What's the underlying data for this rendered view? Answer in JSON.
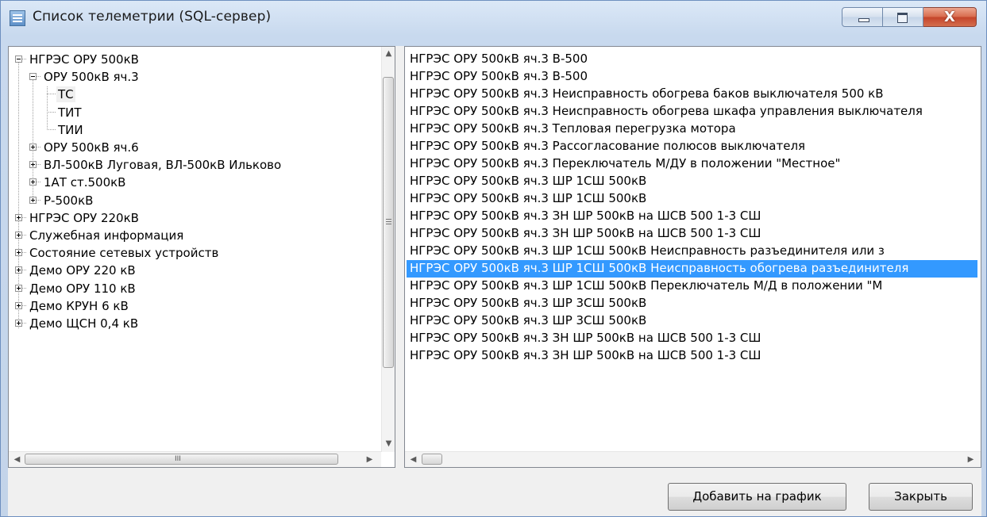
{
  "window": {
    "title": "Список телеметрии (SQL-сервер)",
    "close_glyph": "X"
  },
  "tree": {
    "nodes": [
      {
        "label": "НГРЭС ОРУ 500кВ",
        "level": 0,
        "state": "expanded"
      },
      {
        "label": "ОРУ 500кВ яч.3",
        "level": 1,
        "state": "expanded"
      },
      {
        "label": "ТС",
        "level": 2,
        "state": "leaf",
        "selected": true
      },
      {
        "label": "ТИТ",
        "level": 2,
        "state": "leaf"
      },
      {
        "label": "ТИИ",
        "level": 2,
        "state": "leaf"
      },
      {
        "label": "ОРУ 500кВ яч.6",
        "level": 1,
        "state": "collapsed"
      },
      {
        "label": "ВЛ-500кВ Луговая, ВЛ-500кВ Ильково",
        "level": 1,
        "state": "collapsed"
      },
      {
        "label": "1АТ ст.500кВ",
        "level": 1,
        "state": "collapsed"
      },
      {
        "label": "Р-500кВ",
        "level": 1,
        "state": "collapsed"
      },
      {
        "label": "НГРЭС ОРУ 220кВ",
        "level": 0,
        "state": "collapsed"
      },
      {
        "label": "Служебная информация",
        "level": 0,
        "state": "collapsed"
      },
      {
        "label": "Состояние сетевых устройств",
        "level": 0,
        "state": "collapsed"
      },
      {
        "label": "Демо ОРУ 220 кВ",
        "level": 0,
        "state": "collapsed"
      },
      {
        "label": "Демо ОРУ 110 кВ",
        "level": 0,
        "state": "collapsed"
      },
      {
        "label": "Демо КРУН 6 кВ",
        "level": 0,
        "state": "collapsed"
      },
      {
        "label": "Демо ЩСН 0,4 кВ",
        "level": 0,
        "state": "collapsed"
      }
    ],
    "vscroll_up": "▲",
    "vscroll_down": "▼",
    "hscroll_left": "◀",
    "hscroll_right": "▶",
    "hgrip": "III"
  },
  "list": {
    "items": [
      "НГРЭС ОРУ 500кВ яч.3 В-500",
      "НГРЭС ОРУ 500кВ яч.3 В-500",
      "НГРЭС ОРУ 500кВ яч.3 Неисправность обогрева баков выключателя 500 кВ",
      "НГРЭС ОРУ 500кВ яч.3 Неисправность обогрева шкафа управления выключателя",
      "НГРЭС ОРУ 500кВ яч.3 Тепловая перегрузка мотора",
      "НГРЭС ОРУ 500кВ яч.3 Рассогласование полюсов выключателя",
      "НГРЭС ОРУ 500кВ яч.3 Переключатель М/ДУ в положении \"Местное\"",
      "НГРЭС ОРУ 500кВ яч.3 ШР 1СШ 500кВ",
      "НГРЭС ОРУ 500кВ яч.3 ШР 1СШ 500кВ",
      "НГРЭС ОРУ 500кВ яч.3 ЗН ШР 500кВ на ШСВ 500 1-3 СШ",
      "НГРЭС ОРУ 500кВ яч.3 ЗН ШР 500кВ на ШСВ 500 1-3 СШ",
      "НГРЭС ОРУ 500кВ яч.3 ШР 1СШ 500кВ Неисправность разъединителя или з",
      "НГРЭС ОРУ 500кВ яч.3 ШР 1СШ 500кВ Неисправность обогрева разъединителя",
      "НГРЭС ОРУ 500кВ яч.3 ШР 1СШ 500кВ Переключатель М/Д в положении \"М",
      "НГРЭС ОРУ 500кВ яч.3 ШР 3СШ 500кВ",
      "НГРЭС ОРУ 500кВ яч.3 ШР 3СШ 500кВ",
      "НГРЭС ОРУ 500кВ яч.3 ЗН ШР 500кВ на ШСВ 500 1-3 СШ",
      "НГРЭС ОРУ 500кВ яч.3 ЗН ШР 500кВ на ШСВ 500 1-3 СШ"
    ],
    "selected_index": 12,
    "hscroll_left": "◀",
    "hscroll_right": "▶"
  },
  "buttons": {
    "add_label": "Добавить на график",
    "close_label": "Закрыть"
  },
  "colors": {
    "selection": "#3399ff",
    "close_button": "#c4442a"
  }
}
